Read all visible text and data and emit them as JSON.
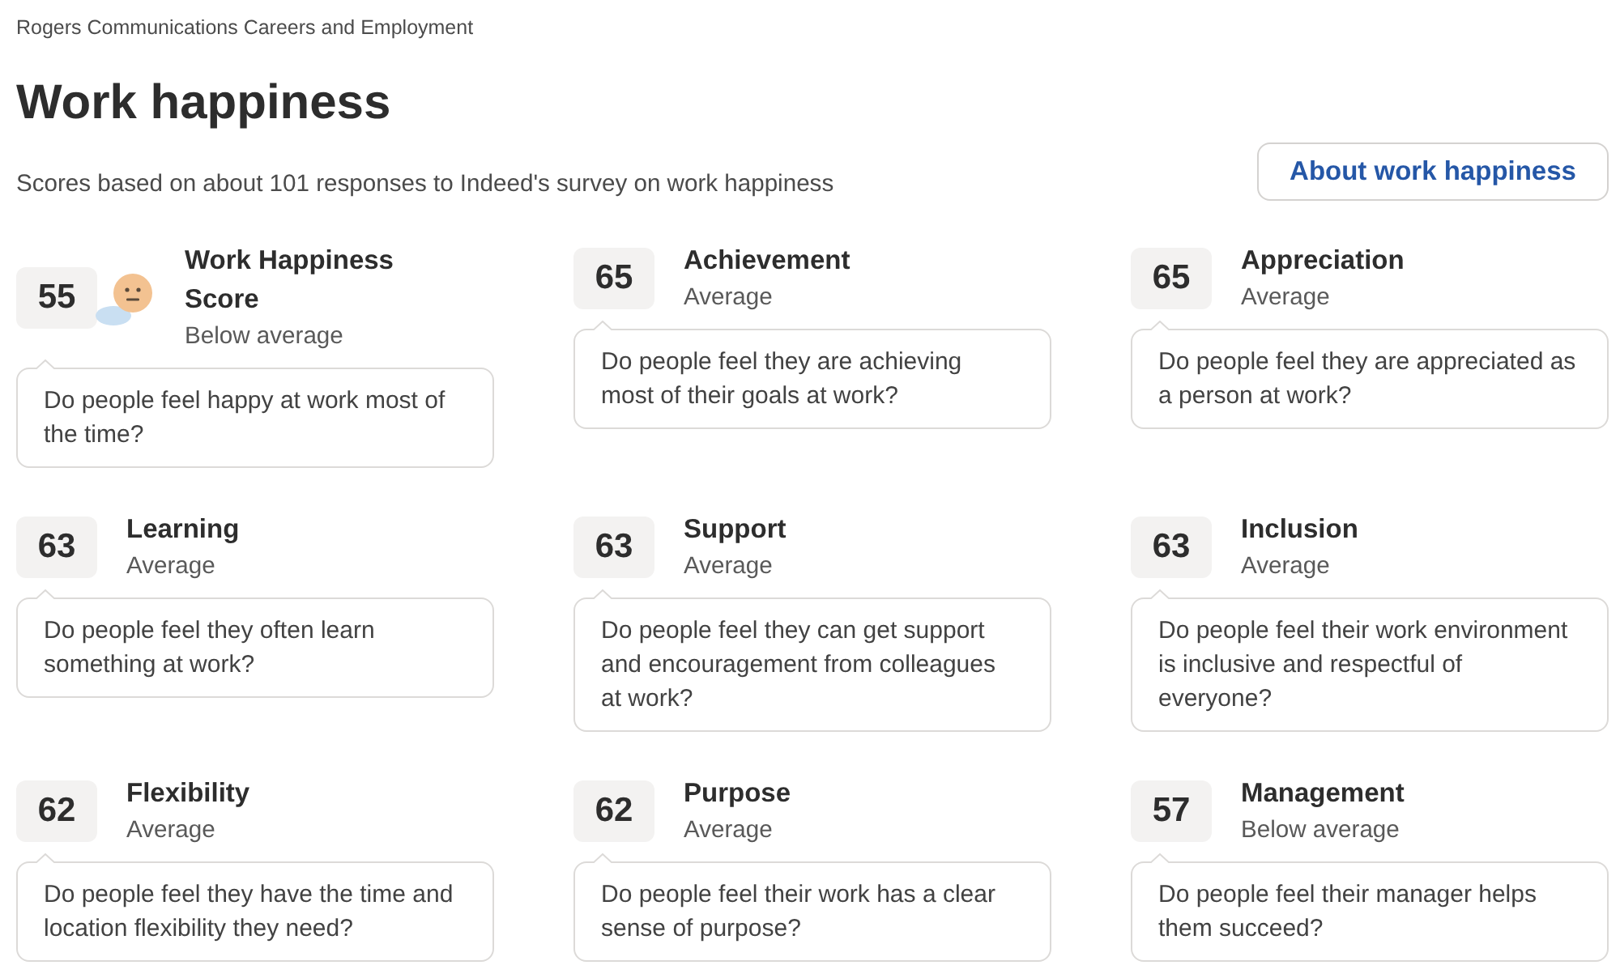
{
  "site_name": "Rogers Communications Careers and Employment",
  "title": "Work happiness",
  "subtitle": "Scores based on about 101 responses to Indeed's survey on work happiness",
  "about_button": "About work happiness",
  "factors": [
    {
      "kind": "overall",
      "score": "55",
      "name": "Work Happiness Score",
      "rating": "Below average",
      "question": "Do people feel happy at work most of the time?"
    },
    {
      "kind": "factor",
      "score": "65",
      "name": "Achievement",
      "rating": "Average",
      "question": "Do people feel they are achieving most of their goals at work?"
    },
    {
      "kind": "factor",
      "score": "65",
      "name": "Appreciation",
      "rating": "Average",
      "question": "Do people feel they are appreciated as a person at work?"
    },
    {
      "kind": "factor",
      "score": "63",
      "name": "Learning",
      "rating": "Average",
      "question": "Do people feel they often learn something at work?"
    },
    {
      "kind": "factor",
      "score": "63",
      "name": "Support",
      "rating": "Average",
      "question": "Do people feel they can get support and encouragement from colleagues at work?"
    },
    {
      "kind": "factor",
      "score": "63",
      "name": "Inclusion",
      "rating": "Average",
      "question": "Do people feel their work environment is inclusive and respectful of everyone?"
    },
    {
      "kind": "factor",
      "score": "62",
      "name": "Flexibility",
      "rating": "Average",
      "question": "Do people feel they have the time and location flexibility they need?"
    },
    {
      "kind": "factor",
      "score": "62",
      "name": "Purpose",
      "rating": "Average",
      "question": "Do people feel their work has a clear sense of purpose?"
    },
    {
      "kind": "factor",
      "score": "57",
      "name": "Management",
      "rating": "Below average",
      "question": "Do people feel their manager helps them succeed?"
    }
  ]
}
